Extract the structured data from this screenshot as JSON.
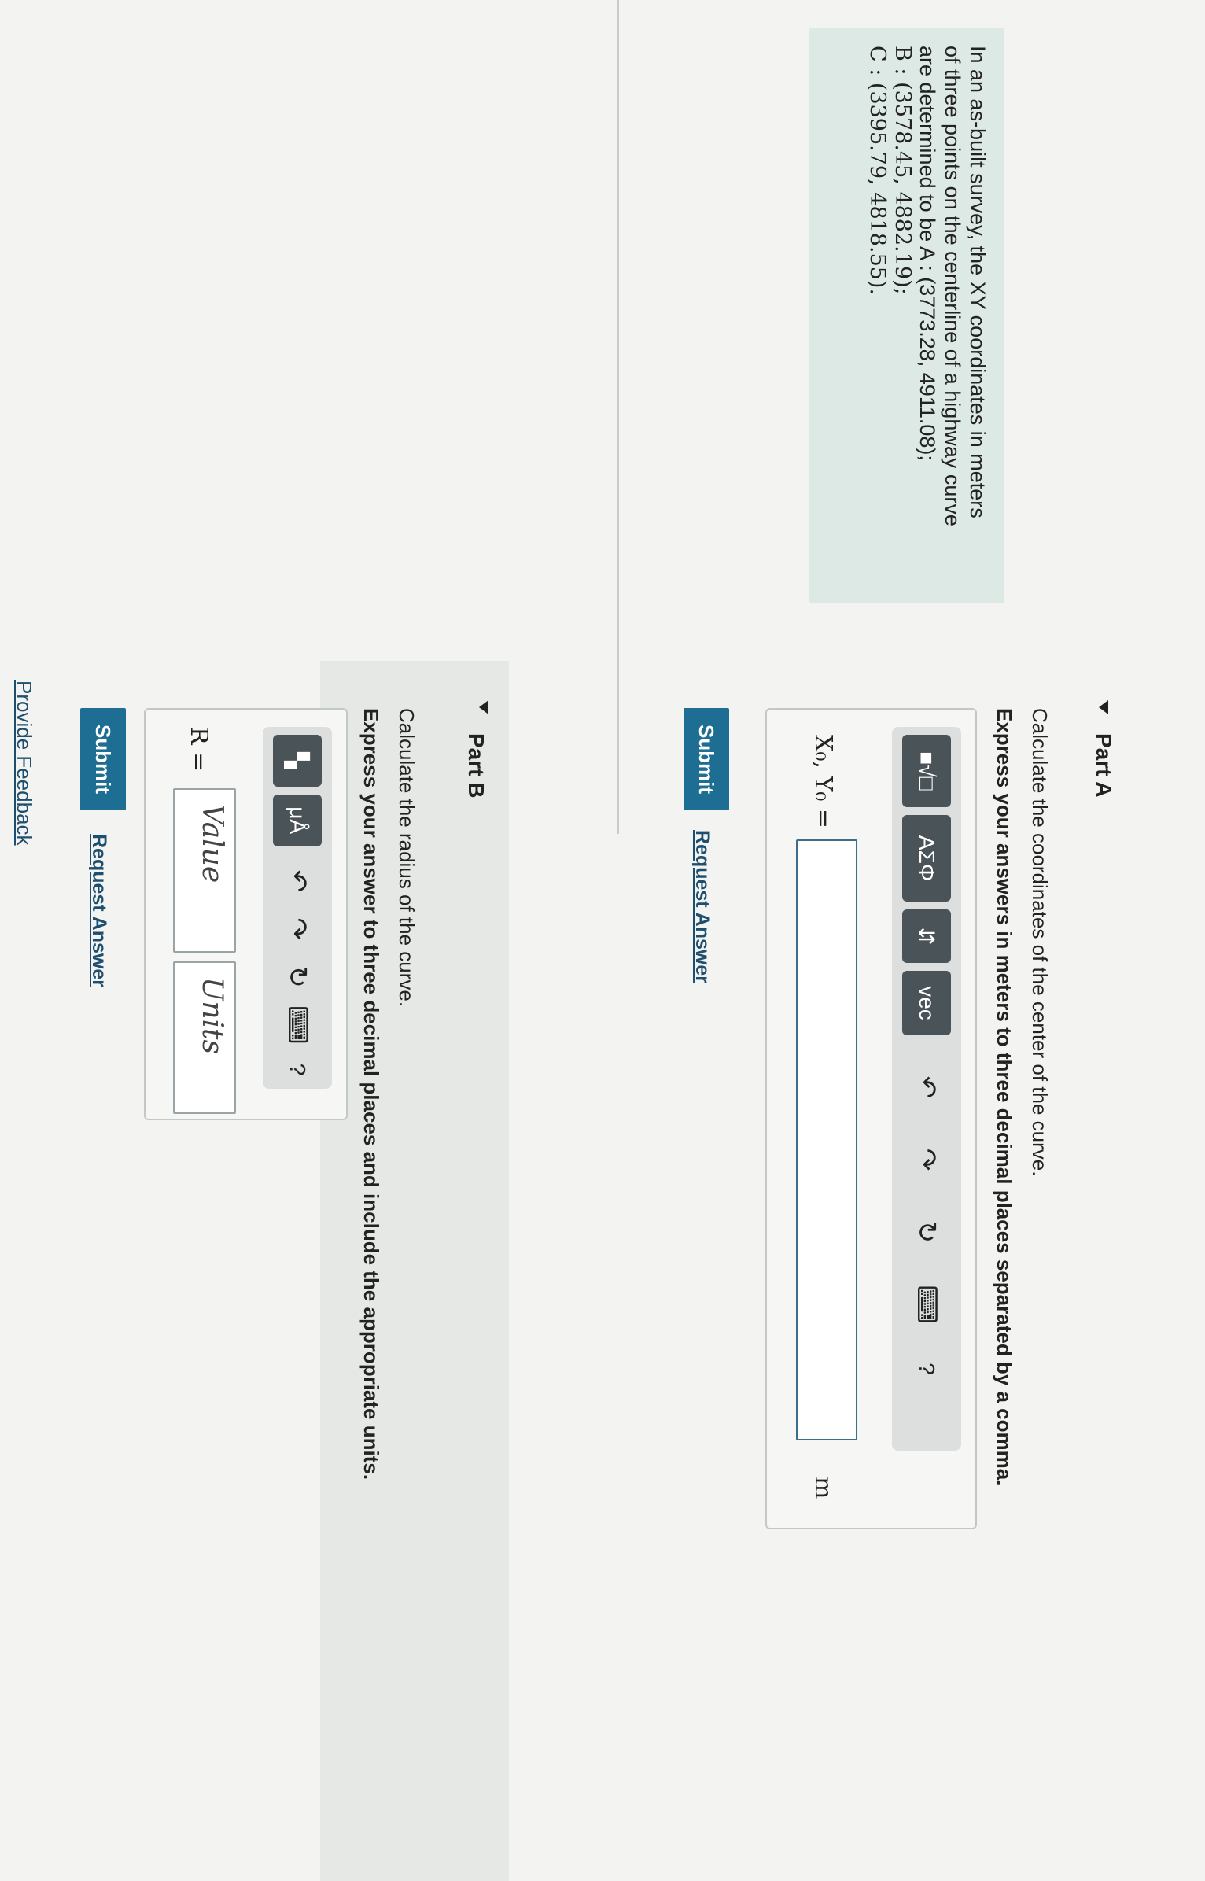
{
  "intro": {
    "line1": "In an as-built survey, the XY coordinates in meters",
    "line2": "of three points on the centerline of a highway curve",
    "line3": "are determined to be A : (3773.28, 4911.08);",
    "line4": "B : (3578.45, 4882.19);",
    "line5": "C : (3395.79, 4818.55)."
  },
  "partA": {
    "title": "Part A",
    "question": "Calculate the coordinates of the center of the curve.",
    "instruction": "Express your answers in meters to three decimal places separated by a comma.",
    "input_label": "X₀, Y₀ =",
    "input_value": "",
    "unit": "m",
    "toolbar": {
      "templates_btn": "■√□",
      "greek_btn": "ΑΣΦ",
      "arrows_btn": "⇵",
      "vec_btn": "vec",
      "help": "?"
    },
    "submit_label": "Submit",
    "request_answer_label": "Request Answer"
  },
  "partB": {
    "title": "Part B",
    "question": "Calculate the radius of the curve.",
    "instruction": "Express your answer to three decimal places and include the appropriate units.",
    "input_label": "R =",
    "value_placeholder": "Value",
    "units_placeholder": "Units",
    "toolbar": {
      "units_btn": "μÅ",
      "help": "?"
    },
    "submit_label": "Submit",
    "request_answer_label": "Request Answer"
  },
  "footer": {
    "feedback_label": "Provide Feedback"
  },
  "colors": {
    "intro_bg": "#dde9e4",
    "submit_bg": "#1e6e94",
    "toolbar_btn": "#4a5358",
    "link": "#1e4f6e"
  }
}
